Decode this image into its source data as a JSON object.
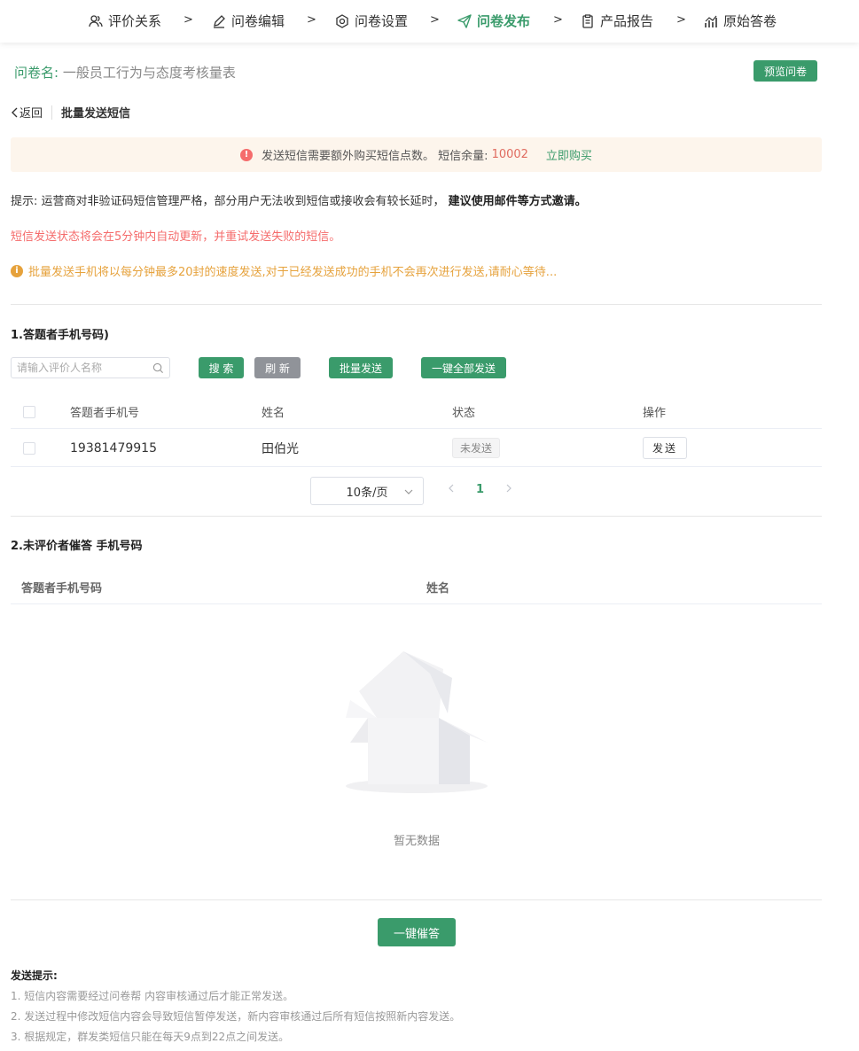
{
  "nav": {
    "steps": [
      {
        "label": "评价关系",
        "icon": "users-icon"
      },
      {
        "label": "问卷编辑",
        "icon": "edit-icon"
      },
      {
        "label": "问卷设置",
        "icon": "settings-icon"
      },
      {
        "label": "问卷发布",
        "icon": "send-icon",
        "active": true
      },
      {
        "label": "产品报告",
        "icon": "clipboard-icon"
      },
      {
        "label": "原始答卷",
        "icon": "chart-icon"
      }
    ],
    "separator": ">"
  },
  "survey": {
    "label": "问卷名:",
    "name": "一般员工行为与态度考核量表",
    "preview_button": "预览问卷"
  },
  "breadcrumb": {
    "back": "返回",
    "current": "批量发送短信"
  },
  "notice": {
    "text": "发送短信需要额外购买短信点数。 短信余量:",
    "balance": "10002",
    "buy": "立即购买"
  },
  "tips": {
    "prefix": "提示:  运营商对非验证码短信管理严格，部分用户无法收到短信或接收会有较长延时，",
    "strong": "建议使用邮件等方式邀请。",
    "red": "短信发送状态将会在5分钟内自动更新，并重试发送失败的短信。",
    "orange": "批量发送手机将以每分钟最多20封的速度发送,对于已经发送成功的手机不会再次进行发送,请耐心等待..."
  },
  "section1": {
    "title": "1.答题者手机号码)",
    "search_placeholder": "请输入评价人名称",
    "search_button": "搜 索",
    "refresh_button": "刷 新",
    "batch_send_button": "批量发送",
    "send_all_button": "一键全部发送",
    "columns": [
      "答题者手机号",
      "姓名",
      "状态",
      "操作"
    ],
    "rows": [
      {
        "phone": "19381479915",
        "name": "田伯光",
        "status": "未发送",
        "action": "发送"
      }
    ],
    "page_size": "10条/页",
    "current_page": "1"
  },
  "section2": {
    "title": "2.未评价者催答 手机号码",
    "columns": [
      "答题者手机号码",
      "姓名"
    ],
    "empty_text": "暂无数据",
    "remind_button": "一键催答"
  },
  "send_tips": {
    "title": "发送提示:",
    "lines": [
      "1. 短信内容需要经过问卷帮 内容审核通过后才能正常发送。",
      "2. 发送过程中修改短信内容会导致短信暂停发送，新内容审核通过后所有短信按照新内容发送。",
      "3. 根据规定，群发类短信只能在每天9点到22点之间发送。"
    ]
  },
  "colors": {
    "primary": "#3a9b6b",
    "danger": "#f56c6c",
    "warning": "#e6a23c",
    "notice_bg": "#fdf5ec"
  }
}
